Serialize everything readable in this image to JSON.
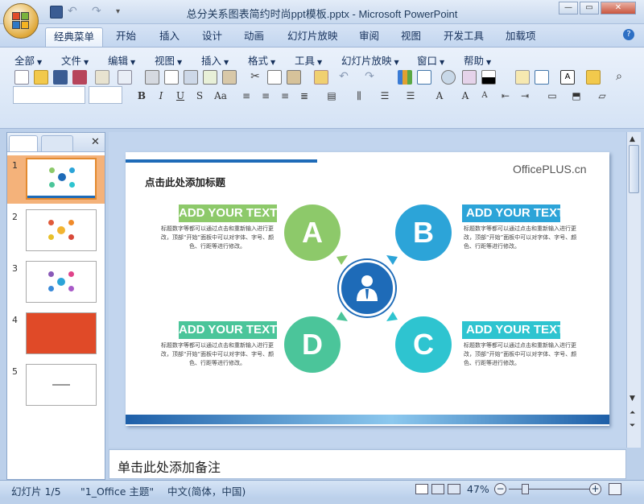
{
  "window": {
    "title": "总分关系图表简约时尚ppt模板.pptx - Microsoft PowerPoint"
  },
  "ribbon_tabs": [
    "经典菜单",
    "开始",
    "插入",
    "设计",
    "动画",
    "幻灯片放映",
    "审阅",
    "视图",
    "开发工具",
    "加载项"
  ],
  "classic_menus": [
    "全部",
    "文件",
    "编辑",
    "视图",
    "插入",
    "格式",
    "工具",
    "幻灯片放映",
    "窗口",
    "帮助"
  ],
  "slides_panel": {
    "slide_numbers": [
      "1",
      "2",
      "3",
      "4",
      "5"
    ],
    "selected": 1
  },
  "slide": {
    "title_placeholder": "点击此处添加标题",
    "logo": "OfficePLUS.cn",
    "items": [
      {
        "letter": "A",
        "heading": "ADD YOUR TEXT",
        "color": "#8dc96a",
        "text": "标题数字等都可以通过点击和重新输入进行更改，顶部“开始”面板中可以对字体、字号、颜色、行距等进行修改。"
      },
      {
        "letter": "B",
        "heading": "ADD YOUR TEXT",
        "color": "#2ca4d8",
        "text": "标题数字等都可以通过点击和重新输入进行更改，顶部“开始”面板中可以对字体、字号、颜色、行距等进行修改。"
      },
      {
        "letter": "D",
        "heading": "ADD YOUR TEXT",
        "color": "#4bc59a",
        "text": "标题数字等都可以通过点击和重新输入进行更改，顶部“开始”面板中可以对字体、字号、颜色、行距等进行修改。"
      },
      {
        "letter": "C",
        "heading": "ADD YOUR TEXT",
        "color": "#2ec4d0",
        "text": "标题数字等都可以通过点击和重新输入进行更改，顶部“开始”面板中可以对字体、字号、颜色、行距等进行修改。"
      }
    ],
    "center_color": "#1e6bb8"
  },
  "notes": {
    "placeholder": "单击此处添加备注"
  },
  "status": {
    "slide_indicator": "幻灯片 1/5",
    "theme": "\"1_Office 主题\"",
    "language": "中文(简体，中国)",
    "zoom": "47%"
  }
}
